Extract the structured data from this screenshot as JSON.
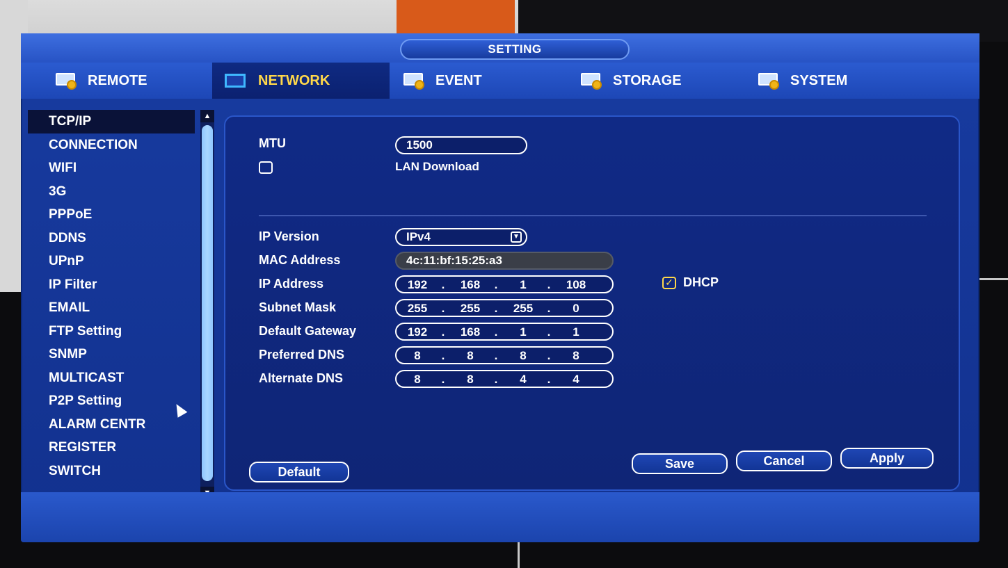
{
  "window": {
    "title": "SETTING"
  },
  "tabs": [
    {
      "label": "REMOTE",
      "icon": "remote-icon",
      "active": false
    },
    {
      "label": "NETWORK",
      "icon": "network-icon",
      "active": true
    },
    {
      "label": "EVENT",
      "icon": "event-icon",
      "active": false
    },
    {
      "label": "STORAGE",
      "icon": "storage-icon",
      "active": false
    },
    {
      "label": "SYSTEM",
      "icon": "system-icon",
      "active": false
    }
  ],
  "sidebar": {
    "items": [
      {
        "label": "TCP/IP",
        "selected": true
      },
      {
        "label": "CONNECTION"
      },
      {
        "label": "WIFI"
      },
      {
        "label": "3G"
      },
      {
        "label": "PPPoE"
      },
      {
        "label": "DDNS"
      },
      {
        "label": "UPnP"
      },
      {
        "label": "IP Filter"
      },
      {
        "label": "EMAIL"
      },
      {
        "label": "FTP Setting"
      },
      {
        "label": "SNMP"
      },
      {
        "label": "MULTICAST"
      },
      {
        "label": "P2P Setting"
      },
      {
        "label": "ALARM CENTR"
      },
      {
        "label": "REGISTER"
      },
      {
        "label": "SWITCH"
      }
    ]
  },
  "form": {
    "mtu_label": "MTU",
    "mtu_value": "1500",
    "lan_download_label": "LAN Download",
    "lan_download_checked": false,
    "ip_version_label": "IP Version",
    "ip_version_value": "IPv4",
    "mac_label": "MAC Address",
    "mac_value": "4c:11:bf:15:25:a3",
    "ip_label": "IP Address",
    "ip_value": [
      "192",
      "168",
      "1",
      "108"
    ],
    "dhcp_label": "DHCP",
    "dhcp_checked": true,
    "subnet_label": "Subnet Mask",
    "subnet_value": [
      "255",
      "255",
      "255",
      "0"
    ],
    "gateway_label": "Default Gateway",
    "gateway_value": [
      "192",
      "168",
      "1",
      "1"
    ],
    "pdns_label": "Preferred DNS",
    "pdns_value": [
      "8",
      "8",
      "8",
      "8"
    ],
    "adns_label": "Alternate DNS",
    "adns_value": [
      "8",
      "8",
      "4",
      "4"
    ]
  },
  "buttons": {
    "default": "Default",
    "save": "Save",
    "cancel": "Cancel",
    "apply": "Apply"
  },
  "colors": {
    "panel_blue": "#12318e",
    "active_tab_text": "#ffd84a",
    "selected_item_bg": "#0a1238"
  }
}
